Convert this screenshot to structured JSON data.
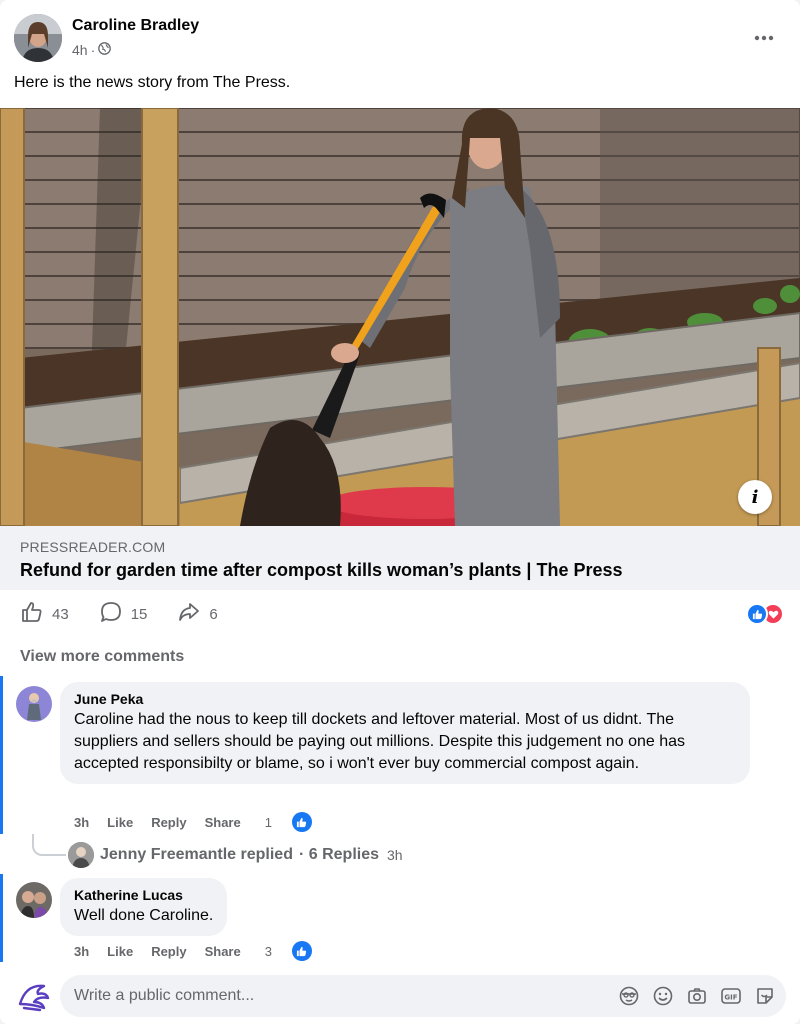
{
  "post": {
    "author": "Caroline Bradley",
    "time": "4h",
    "dot": "·",
    "audience_icon": "globe-icon",
    "text": "Here is the news story from The Press."
  },
  "link": {
    "domain": "PRESSREADER.COM",
    "title": "Refund for garden time after compost kills woman’s plants | The Press",
    "info_label": "i"
  },
  "actions": {
    "likes": "43",
    "comments": "15",
    "shares": "6",
    "reaction_icons": [
      "like-reaction-icon",
      "love-reaction-icon"
    ]
  },
  "comments_section": {
    "view_more": "View more comments",
    "comments": [
      {
        "name": "June Peka",
        "text": "Caroline had the nous to keep till dockets and leftover material. Most of us didnt. The suppliers and sellers should be paying out millions. Despite this judgement no one has accepted responsibilty or blame, so i won't ever buy commercial compost again.",
        "time": "3h",
        "like": "Like",
        "reply": "Reply",
        "share": "Share",
        "reactions": "1"
      },
      {
        "name": "Katherine Lucas",
        "text": "Well done Caroline.",
        "time": "3h",
        "like": "Like",
        "reply": "Reply",
        "share": "Share",
        "reactions": "3"
      }
    ],
    "reply_summary": {
      "name": "Jenny Freemantle replied",
      "count": "· 6 Replies",
      "time": "3h"
    }
  },
  "write_comment": {
    "placeholder": "Write a public comment...",
    "icons": [
      "sticker-face-icon",
      "emoji-icon",
      "camera-icon",
      "gif-icon",
      "sticker-icon"
    ]
  },
  "colors": {
    "accent": "#1877f2",
    "love": "#f33e58",
    "secondary_text": "#65676b",
    "bubble": "#f0f2f5"
  }
}
